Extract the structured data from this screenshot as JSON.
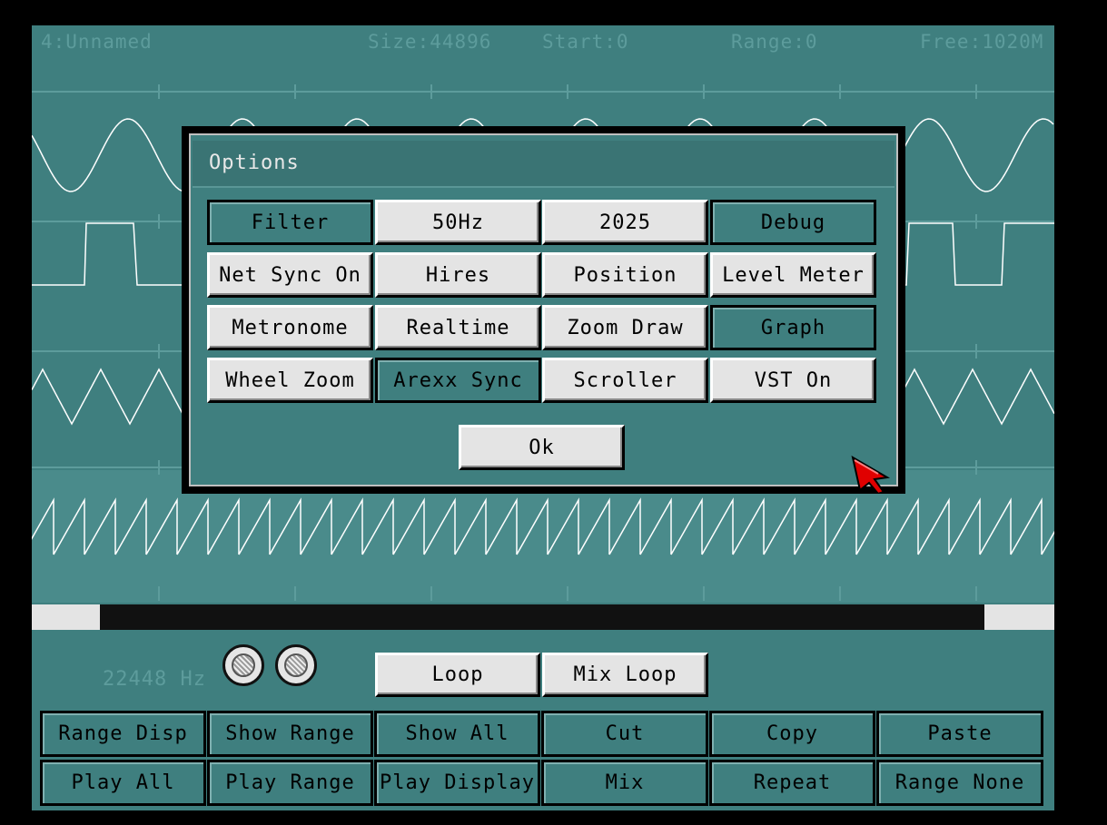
{
  "status": {
    "name": "4:Unnamed",
    "size": "Size:44896",
    "start": "Start:0",
    "range": "Range:0",
    "free": "Free:1020M"
  },
  "dialog": {
    "title": "Options",
    "options": [
      {
        "label": "Filter",
        "on": false
      },
      {
        "label": "50Hz",
        "on": true
      },
      {
        "label": "2025",
        "on": true
      },
      {
        "label": "Debug",
        "on": false
      },
      {
        "label": "Net Sync On",
        "on": true
      },
      {
        "label": "Hires",
        "on": true
      },
      {
        "label": "Position",
        "on": true
      },
      {
        "label": "Level Meter",
        "on": true
      },
      {
        "label": "Metronome",
        "on": true
      },
      {
        "label": "Realtime",
        "on": true
      },
      {
        "label": "Zoom Draw",
        "on": true
      },
      {
        "label": "Graph",
        "on": false
      },
      {
        "label": "Wheel Zoom",
        "on": true
      },
      {
        "label": "Arexx Sync",
        "on": false
      },
      {
        "label": "Scroller",
        "on": true
      },
      {
        "label": "VST On",
        "on": true
      }
    ],
    "ok_label": "Ok"
  },
  "playback": {
    "frequency": "22448 Hz",
    "loop_label": "Loop",
    "mix_loop_label": "Mix Loop"
  },
  "toolbar": {
    "row1": [
      "Range Disp",
      "Show Range",
      "Show All",
      "Cut",
      "Copy",
      "Paste"
    ],
    "row2": [
      "Play All",
      "Play Range",
      "Play Display",
      "Mix",
      "Repeat",
      "Range None"
    ]
  },
  "scrollbar": {
    "visible_start": 0.067,
    "visible_end": 0.932
  },
  "colors": {
    "background": "#3f7f7f",
    "wave": "#ffffff",
    "button_on": "#e4e4e4",
    "cursor": "#e00000"
  }
}
